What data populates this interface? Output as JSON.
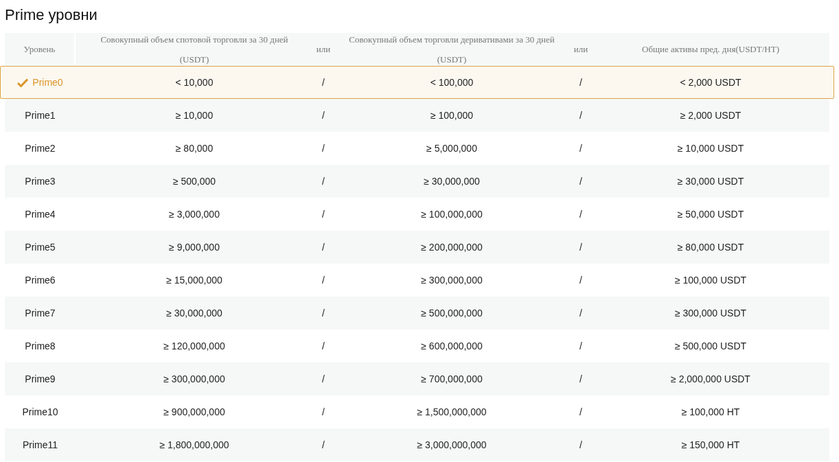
{
  "title": "Prime уровни",
  "table": {
    "columns": [
      {
        "label": "Уровень"
      },
      {
        "label": "Совокупный объем спотовой торговли за 30 дней",
        "unit": "(USDT)"
      },
      {
        "label": "или"
      },
      {
        "label": "Совокупный объем торговли деривативами за 30 дней",
        "unit": "(USDT)"
      },
      {
        "label": "или"
      },
      {
        "label": "Общие активы пред. дня(USDT/HT)"
      }
    ],
    "rows": [
      {
        "level": "Prime0",
        "spot": "< 10,000",
        "or_1": "/",
        "derivatives": "< 100,000",
        "or_2": "/",
        "assets": "< 2,000 USDT",
        "selected": true
      },
      {
        "level": "Prime1",
        "spot": "≥ 10,000",
        "or_1": "/",
        "derivatives": "≥ 100,000",
        "or_2": "/",
        "assets": "≥ 2,000 USDT",
        "selected": false
      },
      {
        "level": "Prime2",
        "spot": "≥ 80,000",
        "or_1": "/",
        "derivatives": "≥ 5,000,000",
        "or_2": "/",
        "assets": "≥ 10,000 USDT",
        "selected": false
      },
      {
        "level": "Prime3",
        "spot": "≥ 500,000",
        "or_1": "/",
        "derivatives": "≥ 30,000,000",
        "or_2": "/",
        "assets": "≥ 30,000 USDT",
        "selected": false
      },
      {
        "level": "Prime4",
        "spot": "≥ 3,000,000",
        "or_1": "/",
        "derivatives": "≥ 100,000,000",
        "or_2": "/",
        "assets": "≥ 50,000 USDT",
        "selected": false
      },
      {
        "level": "Prime5",
        "spot": "≥ 9,000,000",
        "or_1": "/",
        "derivatives": "≥ 200,000,000",
        "or_2": "/",
        "assets": "≥ 80,000 USDT",
        "selected": false
      },
      {
        "level": "Prime6",
        "spot": "≥ 15,000,000",
        "or_1": "/",
        "derivatives": "≥ 300,000,000",
        "or_2": "/",
        "assets": "≥ 100,000 USDT",
        "selected": false
      },
      {
        "level": "Prime7",
        "spot": "≥ 30,000,000",
        "or_1": "/",
        "derivatives": "≥ 500,000,000",
        "or_2": "/",
        "assets": "≥ 300,000 USDT",
        "selected": false
      },
      {
        "level": "Prime8",
        "spot": "≥ 120,000,000",
        "or_1": "/",
        "derivatives": "≥ 600,000,000",
        "or_2": "/",
        "assets": "≥ 500,000 USDT",
        "selected": false
      },
      {
        "level": "Prime9",
        "spot": "≥ 300,000,000",
        "or_1": "/",
        "derivatives": "≥ 700,000,000",
        "or_2": "/",
        "assets": "≥ 2,000,000 USDT",
        "selected": false
      },
      {
        "level": "Prime10",
        "spot": "≥ 900,000,000",
        "or_1": "/",
        "derivatives": "≥ 1,500,000,000",
        "or_2": "/",
        "assets": "≥ 100,000 HT",
        "selected": false
      },
      {
        "level": "Prime11",
        "spot": "≥ 1,800,000,000",
        "or_1": "/",
        "derivatives": "≥ 3,000,000,000",
        "or_2": "/",
        "assets": "≥ 150,000 HT",
        "selected": false
      }
    ]
  }
}
